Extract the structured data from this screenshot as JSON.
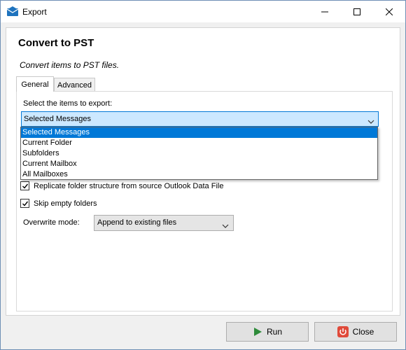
{
  "window": {
    "title": "Export"
  },
  "page": {
    "heading": "Convert to PST",
    "subtitle": "Convert items to PST files."
  },
  "tabs": [
    {
      "label": "General",
      "active": true
    },
    {
      "label": "Advanced",
      "active": false
    }
  ],
  "export_select": {
    "label": "Select the items to export:",
    "value": "Selected Messages",
    "options": [
      "Selected Messages",
      "Current Folder",
      "Subfolders",
      "Current Mailbox",
      "All Mailboxes"
    ],
    "highlighted_index": 0
  },
  "options": {
    "replicate_label": "Replicate folder structure from source Outlook Data File",
    "replicate_checked": true,
    "skip_empty_label": "Skip empty folders",
    "skip_empty_checked": true
  },
  "overwrite": {
    "label": "Overwrite mode:",
    "value": "Append to existing files"
  },
  "buttons": {
    "run": "Run",
    "close": "Close"
  },
  "colors": {
    "accent": "#0078d7",
    "combo_highlight": "#cce8ff",
    "run_icon": "#2e8b3a",
    "close_icon": "#e04a3a"
  }
}
